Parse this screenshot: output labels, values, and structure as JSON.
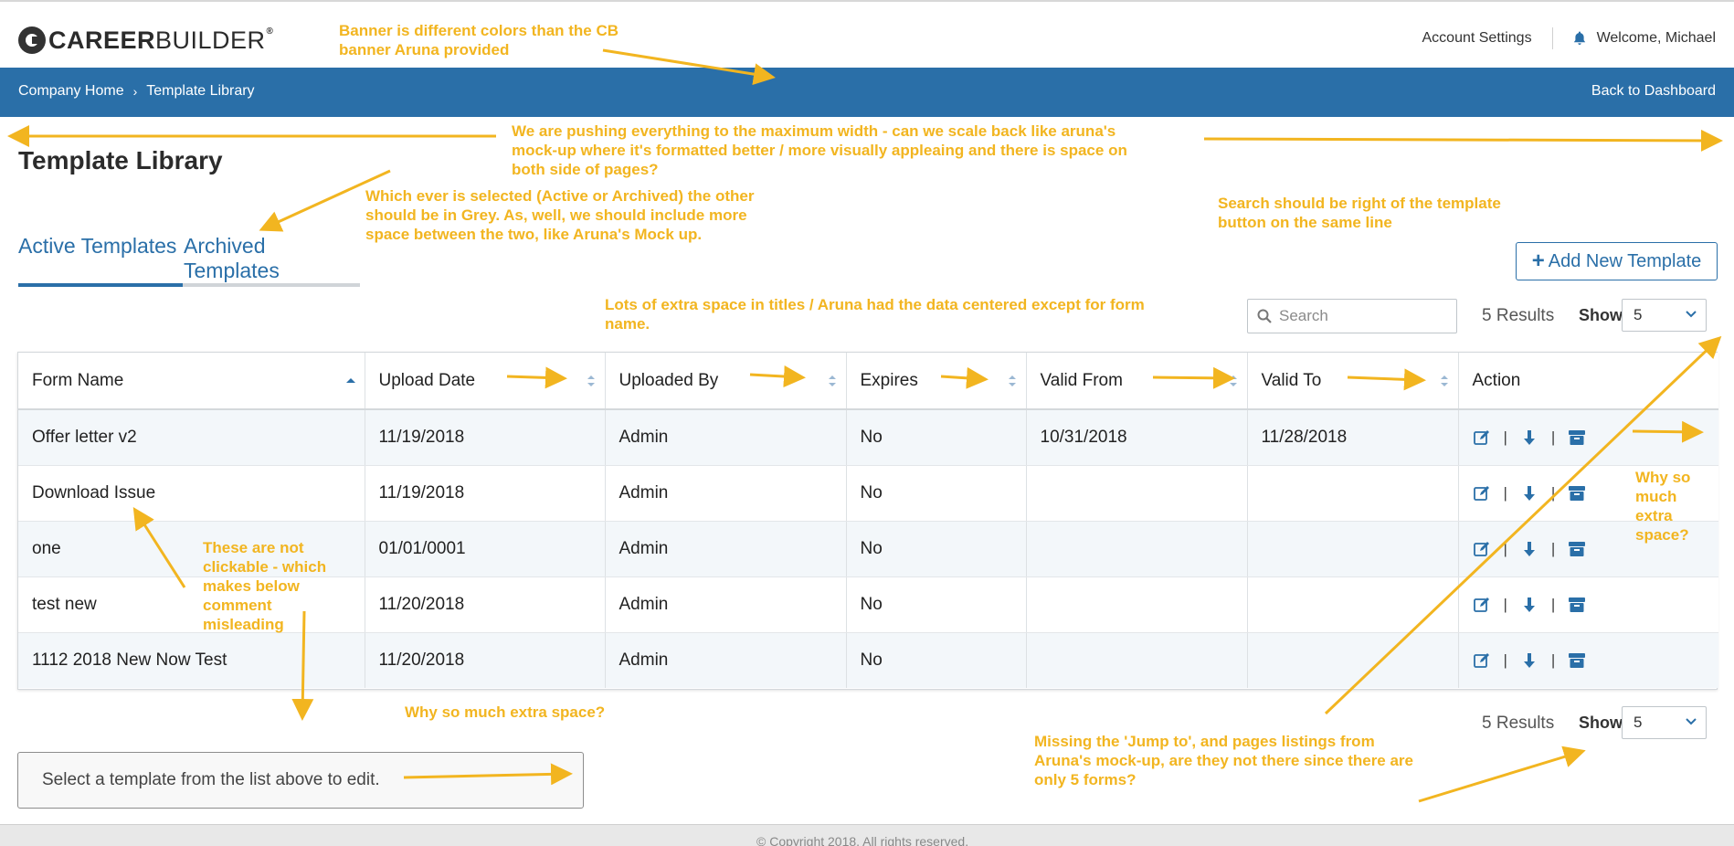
{
  "brand": {
    "logo_bold": "CAREER",
    "logo_rest": "BUILDER",
    "logo_reg": "®"
  },
  "header": {
    "account_settings": "Account Settings",
    "welcome": "Welcome, Michael"
  },
  "breadcrumb": {
    "home": "Company Home",
    "separator": "›",
    "current": "Template Library",
    "back": "Back to Dashboard"
  },
  "page": {
    "title": "Template Library"
  },
  "tabs": {
    "active": "Active Templates",
    "archived": "Archived Templates"
  },
  "toolbar": {
    "add_icon": "+",
    "add_label": "Add New Template",
    "search_placeholder": "Search",
    "results": "5 Results",
    "show_label": "Show",
    "show_value": "5"
  },
  "table": {
    "columns": [
      "Form Name",
      "Upload Date",
      "Uploaded By",
      "Expires",
      "Valid From",
      "Valid To",
      "Action"
    ],
    "rows": [
      {
        "name": "Offer letter v2",
        "upload": "11/19/2018",
        "by": "Admin",
        "expires": "No",
        "from": "10/31/2018",
        "to": "11/28/2018"
      },
      {
        "name": "Download Issue",
        "upload": "11/19/2018",
        "by": "Admin",
        "expires": "No",
        "from": "",
        "to": ""
      },
      {
        "name": "one",
        "upload": "01/01/0001",
        "by": "Admin",
        "expires": "No",
        "from": "",
        "to": ""
      },
      {
        "name": "test new",
        "upload": "11/20/2018",
        "by": "Admin",
        "expires": "No",
        "from": "",
        "to": ""
      },
      {
        "name": "1112 2018 New Now Test",
        "upload": "11/20/2018",
        "by": "Admin",
        "expires": "No",
        "from": "",
        "to": ""
      }
    ],
    "action_separator": "|",
    "action_icons": [
      "edit-icon",
      "download-icon",
      "archive-icon"
    ]
  },
  "bottom": {
    "results": "5 Results",
    "show_label": "Show",
    "show_value": "5",
    "edit_hint": "Select a template from the list above to edit."
  },
  "footer": {
    "copyright": "© Copyright 2018. All rights reserved."
  },
  "colors": {
    "brand_blue": "#2a6fa8",
    "annotation": "#f2b520",
    "row_alt": "#f3f7fa"
  },
  "annotations": {
    "banner": [
      "Banner is different colors than the CB",
      "banner Aruna provided"
    ],
    "width": [
      "We are pushing everything to the maximum width - can we scale back like aruna's",
      "mock-up where it's formatted better / more visually appleaing and there is space on",
      "both side of pages?"
    ],
    "tabs": [
      "Which ever is selected (Active or Archived) the other",
      "should be in Grey.  As, well, we should include more",
      "space between the two, like Aruna's Mock up."
    ],
    "search": [
      "Search should be right of the template",
      "button on the same line"
    ],
    "titles": [
      "Lots of extra space in titles / Aruna had the data centered except for form",
      "name."
    ],
    "clickable": [
      "These are not",
      "clickable - which",
      "makes below",
      "comment",
      "misleading"
    ],
    "action_space": [
      "Why so",
      "much",
      "extra",
      "space?"
    ],
    "extra_space": "Why so much extra space?",
    "jump": [
      "Missing the 'Jump to', and pages listings from",
      "Aruna's mock-up, are they not there since there are",
      "only 5 forms?"
    ]
  }
}
